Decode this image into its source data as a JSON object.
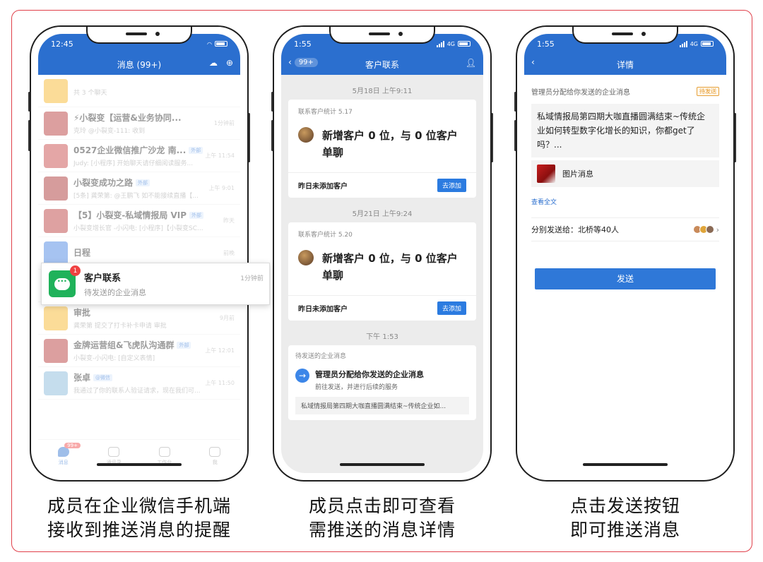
{
  "phone1": {
    "time": "12:45",
    "title": "消息 (99+)",
    "chats": [
      {
        "title": "",
        "sub": "共 3 个聊天",
        "time": "",
        "avatar": "#f6b21b",
        "tag": ""
      },
      {
        "title": "⚡小裂变【运营&业务协同...",
        "sub": "克玲 @小裂变-111: 收到",
        "time": "1分钟前",
        "avatar": "#b12a2a",
        "tag": ""
      },
      {
        "title": "0527企业微信推广沙龙 南...",
        "sub": "Judy: [小程序] 开始聊天请仔细阅读服务...",
        "time": "上午 11:54",
        "avatar": "#c43a3a",
        "tag": "外部"
      },
      {
        "title": "小裂变成功之路",
        "sub": "[5条] 龚荣第: @王鹏飞 如不能接续直播【...",
        "time": "上午 9:01",
        "avatar": "#a52424",
        "tag": "外部"
      },
      {
        "title": "【5】小裂变-私域情报局 VIP",
        "sub": "小裂变增长官 -小闪电: [小程序]【小裂变SC...",
        "time": "昨天",
        "avatar": "#b53030",
        "tag": "外部"
      },
      {
        "title": "日程",
        "sub": "",
        "time": "前晚",
        "avatar": "#3a7be0",
        "tag": ""
      },
      {
        "title": "",
        "sub": "",
        "time": "",
        "avatar": "#1fb25a",
        "tag": ""
      },
      {
        "title": "审批",
        "sub": "龚荣第 提交了打卡补卡申请 审批",
        "time": "9月前",
        "avatar": "#f6b21b",
        "tag": ""
      },
      {
        "title": "金牌运营组&飞虎队沟通群",
        "sub": "小裂变-小闪电: [自定义表情]",
        "time": "上午 12:01",
        "avatar": "#b12a2a",
        "tag": "外部"
      },
      {
        "title": "张卓",
        "sub": "我通过了你的联系人验证请求，现在我们可...",
        "time": "上午 11:50",
        "avatar": "#7fb3d8",
        "tag": "@微信"
      }
    ],
    "tabs": [
      {
        "label": "消息",
        "badge": "99+"
      },
      {
        "label": "通讯录",
        "badge": ""
      },
      {
        "label": "工作台",
        "badge": ""
      },
      {
        "label": "我",
        "badge": ""
      }
    ],
    "popup": {
      "badge": "1",
      "title": "客户联系",
      "sub": "待发送的企业消息",
      "time": "1分钟前"
    }
  },
  "phone2": {
    "time": "1:55",
    "network": "4G",
    "back_badge": "99+",
    "title": "客户联系",
    "blocks": [
      {
        "timestamp": "5月18日 上午9:11",
        "head": "联系客户统计 5.17",
        "main": "新增客户 0 位，与 0 位客户单聊",
        "foot": "昨日未添加客户",
        "button": "去添加"
      },
      {
        "timestamp": "5月21日 上午9:24",
        "head": "联系客户统计 5.20",
        "main": "新增客户 0 位，与 0 位客户单聊",
        "foot": "昨日未添加客户",
        "button": "去添加"
      }
    ],
    "pending": {
      "timestamp": "下午 1:53",
      "head": "待发送的企业消息",
      "title": "管理员分配给你发送的企业消息",
      "sub": "前往发送，并进行后续的服务",
      "quote": "私域情报局第四期大咖直播圆满结束~传统企业如..."
    }
  },
  "phone3": {
    "time": "1:55",
    "network": "4G",
    "title": "详情",
    "header": "管理员分配给你发送的企业消息",
    "status": "待发送",
    "message": "私域情报局第四期大咖直播圆满结束~传统企业如何转型数字化增长的知识，你都get了吗？...",
    "image_label": "图片消息",
    "view_all": "查看全文",
    "send_to": "分别发送给：北桥等40人",
    "send_button": "发送"
  },
  "captions": [
    [
      "成员在企业微信手机端",
      "接收到推送消息的提醒"
    ],
    [
      "成员点击即可查看",
      "需推送的消息详情"
    ],
    [
      "点击发送按钮",
      "即可推送消息"
    ]
  ]
}
